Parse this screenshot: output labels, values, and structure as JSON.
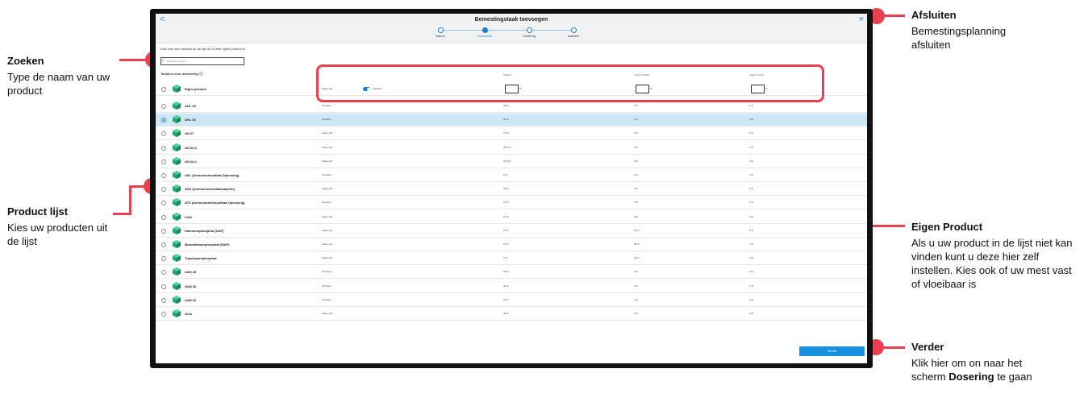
{
  "annotations": {
    "zoeken": {
      "title": "Zoeken",
      "desc": "Type de naam van uw product"
    },
    "product_lijst": {
      "title": "Product lijst",
      "desc": "Kies uw producten uit de lijst"
    },
    "afsluiten": {
      "title": "Afsluiten",
      "desc": "Bemestingsplanning afsluiten"
    },
    "eigen_product": {
      "title": "Eigen Product",
      "desc": "Als u uw product in de lijst niet kan vinden kunt u deze hier zelf instellen. Kies ook of uw mest vast of vloeibaar is"
    },
    "verder": {
      "title": "Verder",
      "desc_pre": "Klik hier om on naar het scherm ",
      "desc_bold": "Dosering",
      "desc_post": " te gaan"
    }
  },
  "app": {
    "title": "Bemestingstaak toevoegen",
    "back_glyph": "<",
    "close_glyph": "×",
    "steps": [
      {
        "label": "Datum",
        "active": false
      },
      {
        "label": "Producten",
        "active": true
      },
      {
        "label": "Dosering",
        "active": false
      },
      {
        "label": "Kaarten",
        "active": false
      }
    ],
    "instruction": "Kies voor een product op de lijst of vul een eigen product in",
    "search": {
      "placeholder": "Vind een product..."
    },
    "tankmix_label": "Tankmix voor bemesting ⓘ",
    "columns": {
      "stikstof": "Stikstof",
      "fosfor": "Fosfor (P2O5)",
      "kalium": "Kalium (K2O)"
    },
    "own_product": {
      "name": "Eigen product",
      "solid": "Vaste stof",
      "liquid": "Vloeistof",
      "pct": "%"
    },
    "products": [
      {
        "name": "AHL 28",
        "state": "Vloeistof",
        "n": "28 %",
        "p": "0 %",
        "k": "0 %",
        "selected": false
      },
      {
        "name": "AHL 30",
        "state": "Vloeistof",
        "n": "30 %",
        "p": "0 %",
        "k": "0 %",
        "selected": true
      },
      {
        "name": "AN 27",
        "state": "Vaste stof",
        "n": "27 %",
        "p": "0 %",
        "k": "0 %",
        "selected": false
      },
      {
        "name": "AN 33,5",
        "state": "Vaste stof",
        "n": "33,5 %",
        "p": "0 %",
        "k": "0 %",
        "selected": false
      },
      {
        "name": "AN 34,4",
        "state": "Vaste stof",
        "n": "34,4 %",
        "p": "0 %",
        "k": "0 %",
        "selected": false
      },
      {
        "name": "ASL (Ammoniumsulfaat-Oplossing)",
        "state": "Vloeistof",
        "n": "8 %",
        "p": "0 %",
        "k": "0 %",
        "selected": false
      },
      {
        "name": "ASS (Ammoniumsulfaatsalpeter)",
        "state": "Vaste stof",
        "n": "26 %",
        "p": "0 %",
        "k": "0 %",
        "selected": false
      },
      {
        "name": "ATS (Ammoniumthiosulfaat-Oplossing)",
        "state": "Vloeistof",
        "n": "12 %",
        "p": "0 %",
        "k": "0 %",
        "selected": false
      },
      {
        "name": "CAN",
        "state": "Vaste stof",
        "n": "27 %",
        "p": "0 %",
        "k": "0 %",
        "selected": false
      },
      {
        "name": "Diammonphosphat (DAP)",
        "state": "Vaste stof",
        "n": "18 %",
        "p": "46 %",
        "k": "0 %",
        "selected": false
      },
      {
        "name": "Monoammonphosphat (MAP)",
        "state": "Vaste stof",
        "n": "12 %",
        "p": "52 %",
        "k": "0 %",
        "selected": false
      },
      {
        "name": "Tripelsuperphosphat",
        "state": "Vaste stof",
        "n": "0 %",
        "p": "46 %",
        "k": "0 %",
        "selected": false
      },
      {
        "name": "UAN 28",
        "state": "Vloeistof",
        "n": "28 %",
        "p": "0 %",
        "k": "0 %",
        "selected": false
      },
      {
        "name": "UAN 30",
        "state": "Vloeistof",
        "n": "30 %",
        "p": "0 %",
        "k": "0 %",
        "selected": false
      },
      {
        "name": "UAN 32",
        "state": "Vloeistof",
        "n": "32 %",
        "p": "0 %",
        "k": "0 %",
        "selected": false
      },
      {
        "name": "Urea",
        "state": "Vaste stof",
        "n": "46 %",
        "p": "0 %",
        "k": "0 %",
        "selected": false
      }
    ],
    "next_button": "Verder"
  },
  "colors": {
    "accent": "#1a8fe0",
    "callout": "#e8404f",
    "selected_row": "#cde7f7",
    "cube": "#20a86e"
  }
}
